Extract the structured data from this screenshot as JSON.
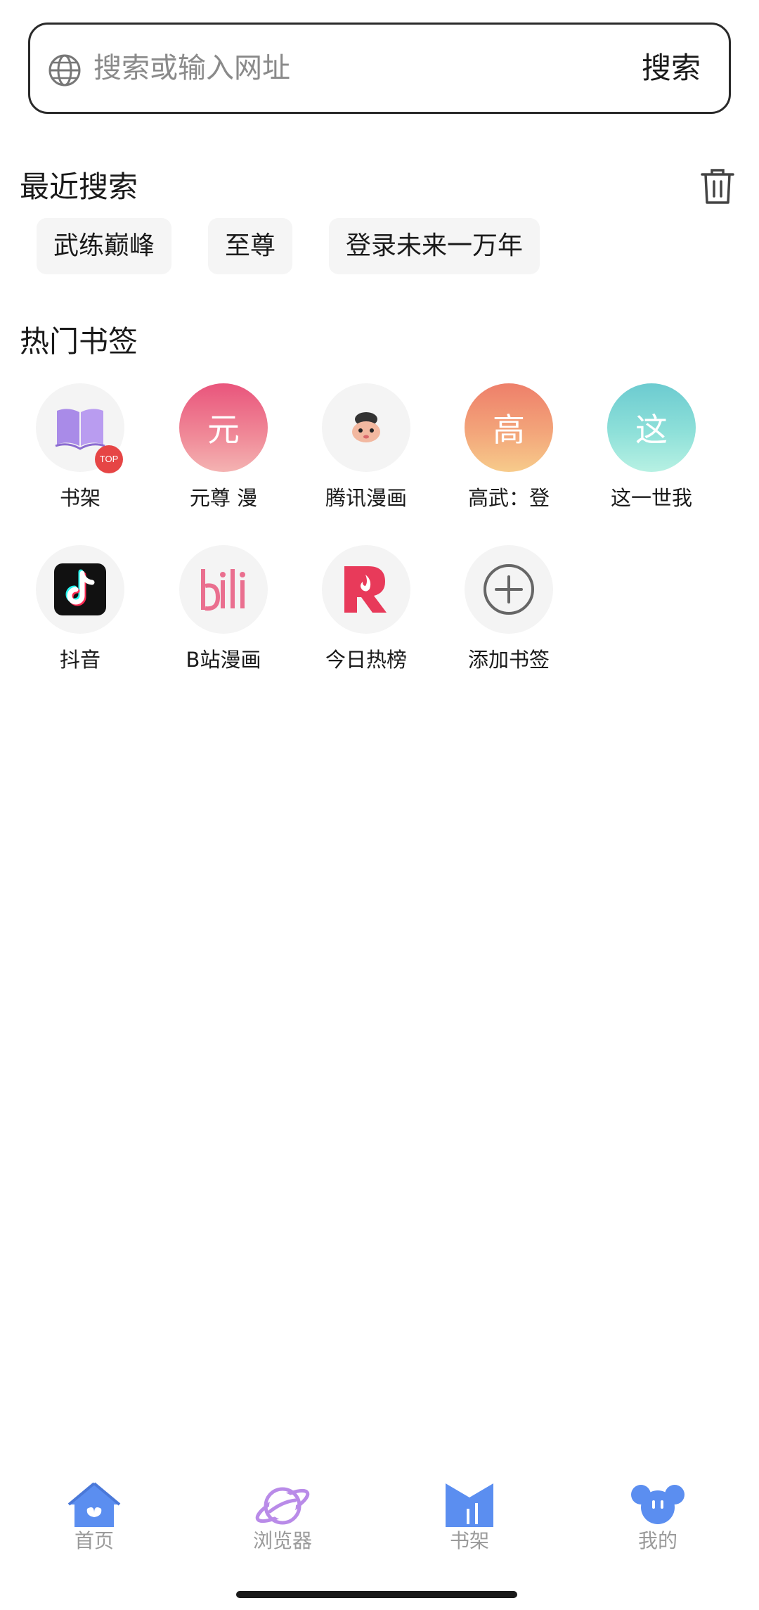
{
  "search": {
    "placeholder": "搜索或输入网址",
    "button_label": "搜索"
  },
  "recent": {
    "title": "最近搜索",
    "chips": [
      "武练巅峰",
      "至尊",
      "登录未来一万年"
    ]
  },
  "bookmarks": {
    "title": "热门书签",
    "items": [
      {
        "label": "书架",
        "icon": "book-icon",
        "badge": "TOP"
      },
      {
        "label": "元尊 漫",
        "icon_text": "元",
        "color": "#ea6a84"
      },
      {
        "label": "腾讯漫画",
        "icon": "tencent-comic-icon"
      },
      {
        "label": "高武：登",
        "icon_text": "高",
        "color": "#ef9a72"
      },
      {
        "label": "这一世我",
        "icon_text": "这",
        "color": "#7fd6d2"
      },
      {
        "label": "抖音",
        "icon": "tiktok-icon"
      },
      {
        "label": "B站漫画",
        "icon": "bilibili-icon"
      },
      {
        "label": "今日热榜",
        "icon": "hot-list-icon"
      },
      {
        "label": "添加书签",
        "icon": "add-icon"
      }
    ]
  },
  "nav": {
    "items": [
      {
        "label": "首页",
        "icon": "home-icon"
      },
      {
        "label": "浏览器",
        "icon": "planet-icon"
      },
      {
        "label": "书架",
        "icon": "bookshelf-icon"
      },
      {
        "label": "我的",
        "icon": "profile-icon"
      }
    ]
  },
  "colors": {
    "accent_blue": "#5b8ef0",
    "accent_purple": "#b98be8",
    "badge_red": "#e64545"
  }
}
